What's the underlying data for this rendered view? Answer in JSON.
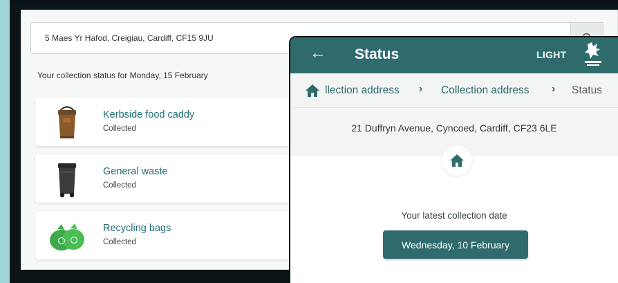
{
  "desktop": {
    "address_value": "5 Maes Yr Hafod, Creigiau, Cardiff, CF15 9JU",
    "search_icon": "search-icon",
    "status_heading": "Your collection status for Monday, 15 February",
    "items": [
      {
        "title": "Kerbside food caddy",
        "status": "Collected",
        "icon": "food-caddy-icon"
      },
      {
        "title": "General waste",
        "status": "Collected",
        "icon": "wheelie-bin-icon"
      },
      {
        "title": "Recycling bags",
        "status": "Collected",
        "icon": "recycling-bags-icon"
      }
    ]
  },
  "mobile": {
    "back_icon": "arrow-left-icon",
    "title": "Status",
    "theme_toggle": "LIGHT",
    "logo": "cardiff-council-logo",
    "breadcrumbs": {
      "home_icon": "home-icon",
      "items": [
        "llection address",
        "Collection address",
        "Status"
      ]
    },
    "address": "21 Duffryn Avenue, Cyncoed, Cardiff, CF23 6LE",
    "latest_label": "Your latest collection date",
    "latest_date": "Wednesday, 10 February"
  },
  "colors": {
    "primary": "#2f6b6d",
    "link": "#1f6f73",
    "page_bg": "#f6f7f7",
    "screen_edge": "#9fd6da"
  }
}
